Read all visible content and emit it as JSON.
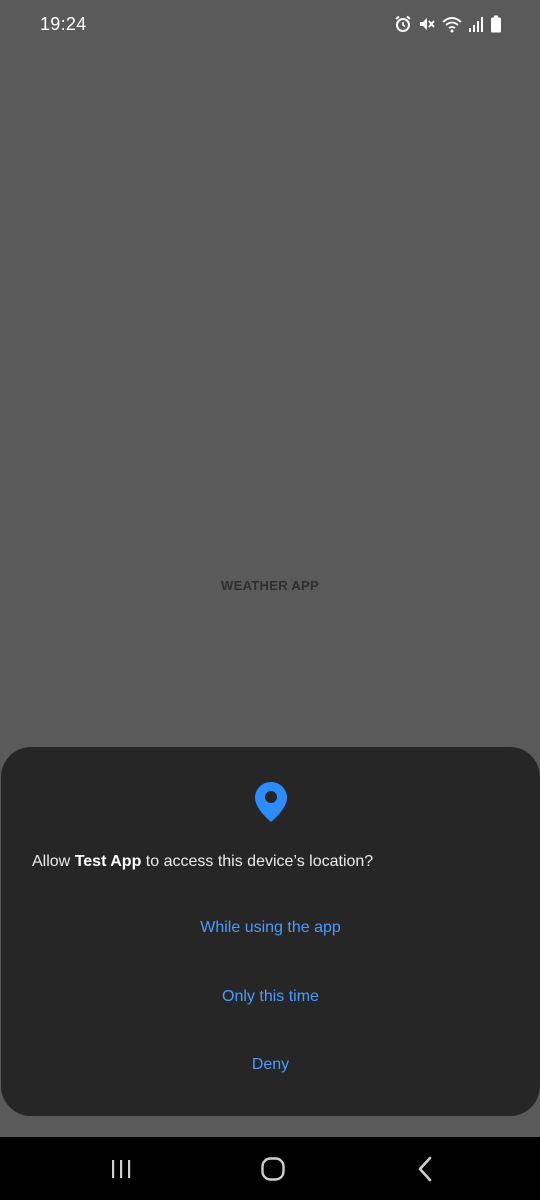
{
  "status_bar": {
    "time": "19:24",
    "icons": [
      "alarm-icon",
      "mute-icon",
      "wifi-icon",
      "signal-icon",
      "battery-icon"
    ]
  },
  "app": {
    "title": "WEATHER APP"
  },
  "dialog": {
    "icon": "location-pin-icon",
    "message_prefix": "Allow ",
    "app_name": "Test App",
    "message_suffix": " to access this device’s location?",
    "buttons": {
      "while_using": "While using the app",
      "only_this_time": "Only this time",
      "deny": "Deny"
    },
    "accent_color": "#4b9bff"
  },
  "nav_bar": {
    "buttons": [
      "recents-icon",
      "home-icon",
      "back-icon"
    ]
  }
}
